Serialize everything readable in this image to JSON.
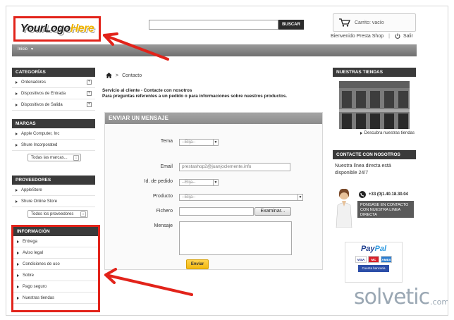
{
  "header": {
    "logo": {
      "part1": "YourLogo",
      "part2": "Here"
    },
    "search_button": "BUSCAR",
    "cart_label": "Carrito: vacío",
    "welcome": "Bienvenido Presta Shop",
    "separator": "|",
    "logout": "Salir"
  },
  "nav": {
    "home": "Inicio"
  },
  "categories": {
    "title": "CATEGORÍAS",
    "items": [
      "Ordenadores",
      "Dispositivos de Entrada",
      "Dispositivos de Salida"
    ]
  },
  "brands": {
    "title": "MARCAS",
    "items": [
      "Apple Computer, Inc",
      "Shure Incorporated"
    ],
    "select": "Todas las marcas..."
  },
  "suppliers": {
    "title": "PROVEEDORES",
    "items": [
      "AppleStore",
      "Shure Online Store"
    ],
    "select": "Todos los proveedores"
  },
  "information": {
    "title": "INFORMACIÓN",
    "items": [
      "Entrega",
      "Aviso legal",
      "Condiciones de uso",
      "Sobre",
      "Pago seguro",
      "Nuestras tiendas"
    ]
  },
  "breadcrumb": {
    "separator": ">",
    "current": "Contacto"
  },
  "intro": {
    "line1": "Servicio al cliente - Contacte con nosotros",
    "line2": "Para preguntas referentes a un pedido o para informaciones sobre nuestros productos."
  },
  "form": {
    "title": "ENVIAR UN MENSAJE",
    "tema_label": "Tema",
    "tema_value": "--Elija--",
    "email_label": "Email",
    "email_value": "prestashop2@juanjoclemente.info",
    "order_label": "Id. de pedido",
    "order_value": "--Elija--",
    "product_label": "Producto",
    "product_value": "--Elija--",
    "file_label": "Fichero",
    "file_button": "Examinar...",
    "message_label": "Mensaje",
    "send_button": "Enviar"
  },
  "stores": {
    "title": "NUESTRAS TIENDAS",
    "link": "Descubra nuestras tiendas"
  },
  "contact": {
    "title": "CONTACTE CON NOSOTROS",
    "text": "Nuestra línea directa está disponible 24/7",
    "phone": "+33 (0)1.40.18.30.04",
    "button": "PONGASE EN CONTACTO CON NUESTRA LINEA DIRECTA"
  },
  "payment": {
    "title_a": "Pay",
    "title_b": "Pal",
    "cards": [
      "VISA",
      "MC",
      "AMEX"
    ],
    "bank": "Cuenta bancaria"
  },
  "watermark": {
    "main": "solvetic",
    "domain": ".com"
  },
  "colors": {
    "highlight": "#e2231a",
    "dark": "#3a3a3a",
    "button": "#f2b90f"
  }
}
